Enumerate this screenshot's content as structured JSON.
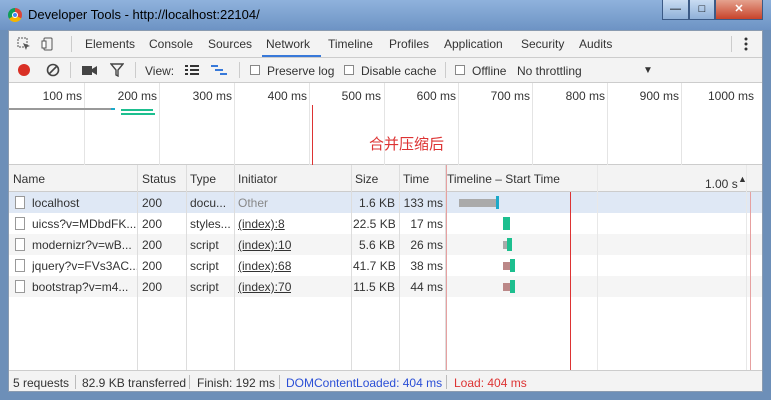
{
  "window": {
    "title": "Developer Tools - http://localhost:22104/"
  },
  "tabs": [
    {
      "label": "Elements"
    },
    {
      "label": "Console"
    },
    {
      "label": "Sources"
    },
    {
      "label": "Network",
      "active": true
    },
    {
      "label": "Timeline"
    },
    {
      "label": "Profiles"
    },
    {
      "label": "Application"
    },
    {
      "label": "Security"
    },
    {
      "label": "Audits"
    }
  ],
  "toolbar": {
    "view_label": "View:",
    "preserve_log": "Preserve log",
    "disable_cache": "Disable cache",
    "offline": "Offline",
    "throttling": "No throttling"
  },
  "overview": {
    "ticks": [
      "100 ms",
      "200 ms",
      "300 ms",
      "400 ms",
      "500 ms",
      "600 ms",
      "700 ms",
      "800 ms",
      "900 ms",
      "1000 ms"
    ],
    "annotation": "合并压缩后"
  },
  "columns": {
    "name": "Name",
    "status": "Status",
    "type": "Type",
    "initiator": "Initiator",
    "size": "Size",
    "time": "Time",
    "timeline": "Timeline – Start Time",
    "timeline_scale": "1.00 s"
  },
  "requests": [
    {
      "name": "localhost",
      "status": "200",
      "type": "docu...",
      "initiator": "Other",
      "size": "1.6 KB",
      "time": "133 ms"
    },
    {
      "name": "uicss?v=MDbdFK...",
      "status": "200",
      "type": "styles...",
      "initiator": "(index):8",
      "size": "22.5 KB",
      "time": "17 ms"
    },
    {
      "name": "modernizr?v=wB...",
      "status": "200",
      "type": "script",
      "initiator": "(index):10",
      "size": "5.6 KB",
      "time": "26 ms"
    },
    {
      "name": "jquery?v=FVs3AC...",
      "status": "200",
      "type": "script",
      "initiator": "(index):68",
      "size": "41.7 KB",
      "time": "38 ms"
    },
    {
      "name": "bootstrap?v=m4...",
      "status": "200",
      "type": "script",
      "initiator": "(index):70",
      "size": "11.5 KB",
      "time": "44 ms"
    }
  ],
  "summary": {
    "requests": "5 requests",
    "transferred": "82.9 KB transferred",
    "finish": "Finish: 192 ms",
    "dcl": "DOMContentLoaded: 404 ms",
    "load": "Load: 404 ms"
  },
  "colors": {
    "accent": "#3879d9",
    "dcl": "#2b4fd6",
    "load": "#d33",
    "record": "#d93025",
    "waiting": "#aaa",
    "receiving": "#1ca9c9",
    "script": "#1dbf8f"
  }
}
